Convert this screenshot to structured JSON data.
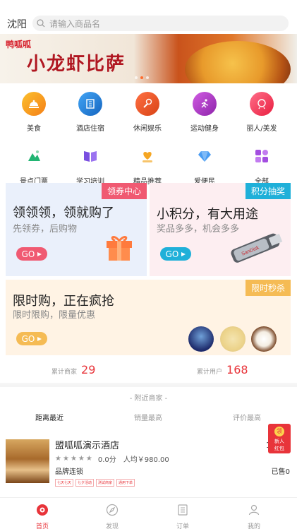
{
  "header": {
    "city": "沈阳",
    "search_placeholder": "请输入商品名"
  },
  "banner": {
    "logo_text": "鸭呱呱",
    "title": "小龙虾比萨",
    "active_dot": 1
  },
  "categories": [
    {
      "label": "美食",
      "icon": "food-icon",
      "color": "#f7a21b"
    },
    {
      "label": "酒店住宿",
      "icon": "hotel-icon",
      "color": "#2e8df0"
    },
    {
      "label": "休闲娱乐",
      "icon": "mic-icon",
      "color": "#f14a2c"
    },
    {
      "label": "运动健身",
      "icon": "run-icon",
      "color": "#b53ad7"
    },
    {
      "label": "丽人/美发",
      "icon": "beauty-icon",
      "color": "#ef4c68"
    },
    {
      "label": "景点门票",
      "icon": "scenic-icon",
      "color": "#22b573"
    },
    {
      "label": "学习培训",
      "icon": "book-icon",
      "color": "#7a4fe0"
    },
    {
      "label": "精品推荐",
      "icon": "heart-hand-icon",
      "color": "#f5a623"
    },
    {
      "label": "爱便民",
      "icon": "diamond-heart-icon",
      "color": "#4a9cf2"
    },
    {
      "label": "全部",
      "icon": "grid-icon",
      "color": "#a34ee0"
    }
  ],
  "promos": {
    "coupon": {
      "title": "领领领，领就购了",
      "subtitle": "先领券，后购物",
      "tag": "领券中心",
      "go": "GO"
    },
    "points": {
      "title": "小积分，有大用途",
      "subtitle": "奖品多多，机会多多",
      "tag": "积分抽奖",
      "go": "GO",
      "usb_text": "SanDisk"
    },
    "flash": {
      "title": "限时购，正在疯抢",
      "subtitle": "限时限购，限量优惠",
      "tag": "限时秒杀",
      "go": "GO"
    }
  },
  "stats": {
    "merchants_label": "累计商家",
    "merchants_value": "29",
    "users_label": "累计用户",
    "users_value": "168"
  },
  "nearby": {
    "title": "- 附近商家 -",
    "sorts": [
      "距离最近",
      "销量最高",
      "评价最高"
    ],
    "active_sort": 0
  },
  "business": {
    "name": "盟呱呱演示酒店",
    "distance": "11",
    "score": "0.0分",
    "avg_price": "人均￥980.00",
    "brand": "品牌连锁",
    "sold": "已售0",
    "tags": [
      "七天七天",
      "七夕活动",
      "测试商家",
      "通用下单"
    ]
  },
  "redpacket": {
    "coin": "领",
    "line1": "新人",
    "line2": "红包"
  },
  "tabbar": [
    {
      "label": "首页",
      "icon": "home-icon",
      "active": true
    },
    {
      "label": "发现",
      "icon": "compass-icon",
      "active": false
    },
    {
      "label": "订单",
      "icon": "order-icon",
      "active": false
    },
    {
      "label": "我的",
      "icon": "user-icon",
      "active": false
    }
  ],
  "colors": {
    "accent": "#e8343a",
    "coupon_tag": "#f05a72",
    "points_tag": "#1fb0d9",
    "flash_tag": "#f5bb54"
  }
}
